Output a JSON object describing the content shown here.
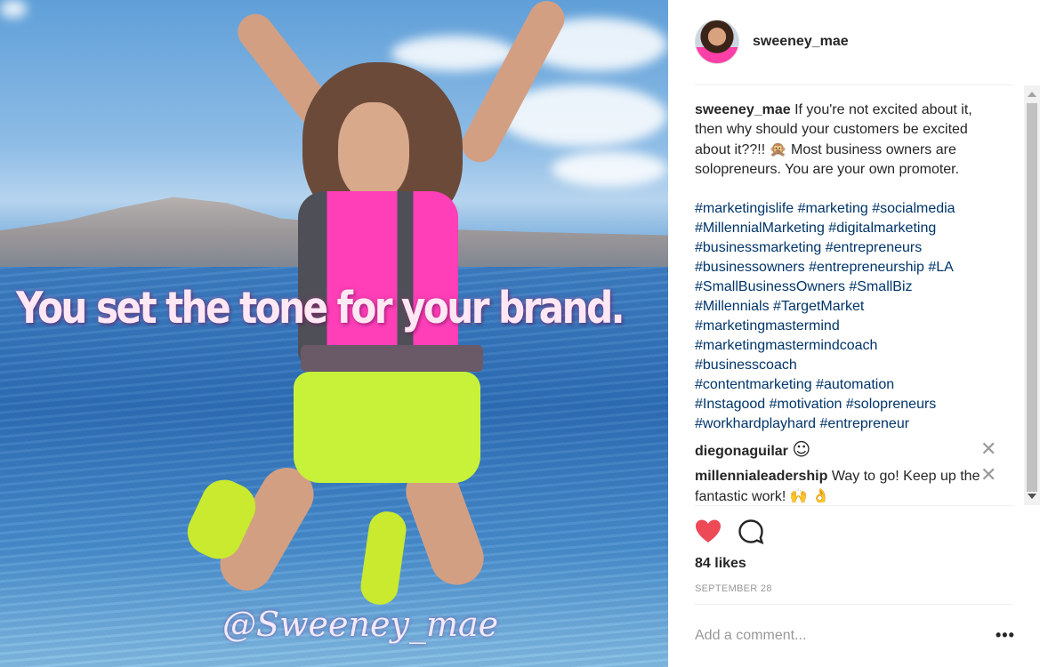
{
  "photo": {
    "overlay_text": "You set the tone for your brand.",
    "watermark": "@Sweeney_mae"
  },
  "post": {
    "username": "sweeney_mae",
    "caption": {
      "user": "sweeney_mae",
      "text_a": "If you're not excited about it, then why should your customers be excited about it??!!",
      "emoji_a": "🙊",
      "text_b": "Most business owners are solopreneurs. You are your own promoter.",
      "hashtags": [
        "#marketingislife #marketing #socialmedia",
        "#MillennialMarketing #digitalmarketing",
        "#businessmarketing #entrepreneurs",
        "#businessowners #entrepreneurship #LA",
        "#SmallBusinessOwners #SmallBiz",
        "#Millennials #TargetMarket",
        "#marketingmastermind",
        "#marketingmastermindcoach",
        "#businesscoach",
        "#contentmarketing #automation",
        "#Instagood #motivation #solopreneurs",
        "#workhardplayhard #entrepreneur"
      ]
    },
    "comments": [
      {
        "user": "diegonaguilar",
        "text": "",
        "emoji": "☺"
      },
      {
        "user": "millennialeadership",
        "text": "Way to go! Keep up the fantastic work!",
        "emoji": "🙌 👌"
      }
    ],
    "likes": "84 likes",
    "date": "SEPTEMBER 28",
    "comment_placeholder": "Add a comment...",
    "more_label": "•••",
    "remove_glyph": "✕"
  },
  "colors": {
    "heart": "#ed4956",
    "hashtag": "#003569",
    "muted": "#999999"
  }
}
